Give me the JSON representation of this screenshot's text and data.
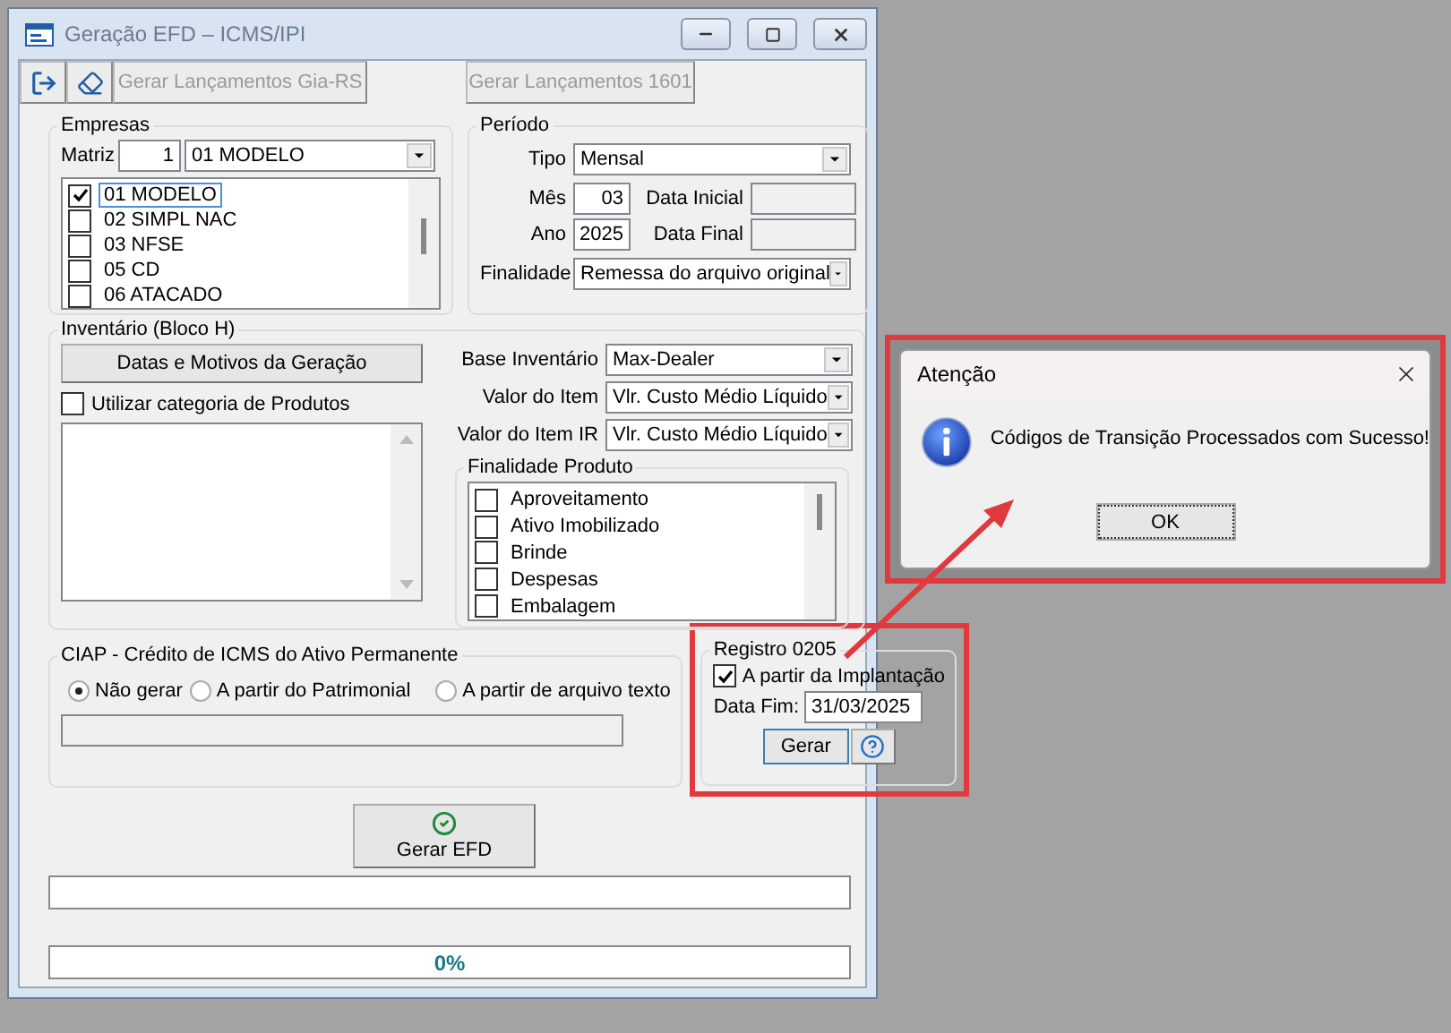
{
  "window": {
    "title": "Geração EFD – ICMS/IPI"
  },
  "toolbar": {
    "buttons": [
      {
        "label": "Gerar Lançamentos Gia-RS",
        "disabled": true
      },
      {
        "label": "Gerar Lançamentos 1601",
        "disabled": true
      }
    ]
  },
  "empresas": {
    "title": "Empresas",
    "matriz_label": "Matriz",
    "matriz_value": "1",
    "select_value": "01 MODELO",
    "items": [
      {
        "label": "01 MODELO",
        "checked": true,
        "selected": true
      },
      {
        "label": "02 SIMPL NAC",
        "checked": false,
        "selected": false
      },
      {
        "label": "03 NFSE",
        "checked": false,
        "selected": false
      },
      {
        "label": "05 CD",
        "checked": false,
        "selected": false
      },
      {
        "label": "06 ATACADO",
        "checked": false,
        "selected": false
      }
    ]
  },
  "periodo": {
    "title": "Período",
    "tipo_label": "Tipo",
    "tipo_value": "Mensal",
    "mes_label": "Mês",
    "mes_value": "03",
    "ano_label": "Ano",
    "ano_value": "2025",
    "data_inicial_label": "Data Inicial",
    "data_final_label": "Data Final",
    "finalidade_label": "Finalidade",
    "finalidade_value": "Remessa do arquivo original"
  },
  "inventario": {
    "title": "Inventário (Bloco H)",
    "dates_button": "Datas e Motivos da Geração",
    "categoria": {
      "label": "Utilizar categoria de Produtos",
      "checked": false
    },
    "selects": [
      {
        "label": "Base Inventário",
        "value": "Max-Dealer"
      },
      {
        "label": "Valor do Item",
        "value": "Vlr. Custo Médio Líquido"
      },
      {
        "label": "Valor do Item IR",
        "value": "Vlr. Custo Médio Líquido"
      }
    ],
    "finalidade_produto": {
      "title": "Finalidade Produto",
      "items": [
        {
          "label": "Aproveitamento",
          "checked": false
        },
        {
          "label": "Ativo Imobilizado",
          "checked": false
        },
        {
          "label": "Brinde",
          "checked": false
        },
        {
          "label": "Despesas",
          "checked": false
        },
        {
          "label": "Embalagem",
          "checked": false
        }
      ]
    }
  },
  "ciap": {
    "title": "CIAP - Crédito de ICMS do Ativo Permanente",
    "options": [
      {
        "label": "Não gerar",
        "selected": true
      },
      {
        "label": "A partir do Patrimonial",
        "selected": false
      },
      {
        "label": "A partir de arquivo texto",
        "selected": false
      }
    ]
  },
  "registro_0205": {
    "title": "Registro 0205",
    "implantacao": {
      "label": "A partir da Implantação",
      "checked": true
    },
    "data_fim_label": "Data Fim:",
    "data_fim_value": "31/03/2025",
    "gerar_button": "Gerar"
  },
  "gerar_efd_button": "Gerar EFD",
  "progress": [
    {
      "level": 0
    },
    {
      "level": 0,
      "reading": "0%"
    }
  ],
  "dialog": {
    "title": "Atenção",
    "message": "Códigos de Transição Processados com Sucesso!",
    "ok_button": "OK"
  }
}
